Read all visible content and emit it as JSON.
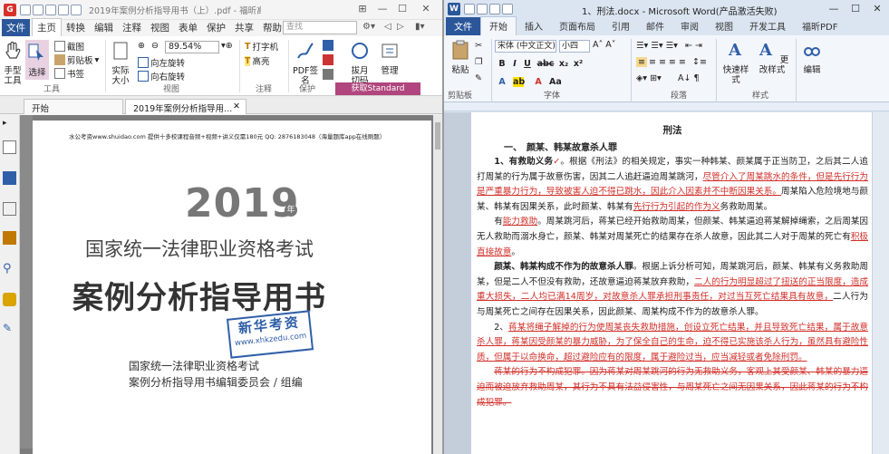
{
  "left_app": {
    "title": "2019年案例分析指导用书（上）.pdf - 福昕高级PD...",
    "tabs": [
      "文件",
      "主页",
      "转换",
      "编辑",
      "注释",
      "视图",
      "表单",
      "保护",
      "共享",
      "帮助"
    ],
    "search_placeholder": "查找",
    "ribbon": {
      "hand_tool": "手型工具",
      "select": "选择",
      "screenshot": "截图",
      "clipboard": "剪贴板",
      "bookmark": "书签",
      "group_tools": "工具",
      "actual_size": "实际大小",
      "zoom": "89.54%",
      "rotate_left": "向左旋转",
      "rotate_right": "向右旋转",
      "group_view": "视图",
      "typewriter": "打字机",
      "highlight": "高亮",
      "group_comment": "注释",
      "pdf_sign": "PDF签名",
      "group_protect": "保护",
      "fill": "拔月",
      "fill2": "切码",
      "manage": "管理",
      "get_standard": "获取Standard"
    },
    "doc_tabs": [
      "开始",
      "2019年案例分析指导用..."
    ],
    "page": {
      "header": "水公考资www.shuidao.com    提供十多校课程音频+视频+讲义仅需180元    QQ: 2876183048（海量题库app在线刷题）",
      "year": "2019",
      "nian": "年",
      "subtitle": "国家统一法律职业资格考试",
      "main_title": "案例分析指导用书",
      "stamp_line1": "新华考资",
      "stamp_line2": "www.xhkzedu.com",
      "org_line1": "国家统一法律职业资格考试",
      "org_line2": "案例分析指导用书编辑委员会 / 组编"
    }
  },
  "right_app": {
    "title": "1、刑法.docx - Microsoft Word(产品激活失败)",
    "tabs": [
      "文件",
      "开始",
      "插入",
      "页面布局",
      "引用",
      "邮件",
      "审阅",
      "视图",
      "开发工具",
      "福昕PDF"
    ],
    "ribbon": {
      "paste": "粘贴",
      "font_name": "宋体 (中文正文)",
      "font_size": "小四",
      "group_clipboard": "剪贴板",
      "group_font": "字体",
      "group_paragraph": "段落",
      "quick_styles": "快速样式",
      "change_styles": "更改样式",
      "edit": "编辑",
      "group_styles": "样式"
    },
    "doc": {
      "title": "刑法",
      "heading": "一、　颜某、韩某故意杀人罪",
      "p1_bold": "1、有救助义务",
      "p1_check": "✓",
      "p1_a": "。根据《刑法》的相关规定，事实一种韩某、颜某属于正当防卫，之后其二人追打周某的行为属于故意伤害，因其二人追赶逼迫周某跳河，",
      "p1_red": "尽管介入了周某跳水的条件，但是先行行为是严重暴力行为，导致被害人迫不得已跳水，因此介入因素并不中断因果关系。",
      "p1_b": "周某陷入危险境地与颜某、韩某有因果关系，此时颜某、韩某有",
      "p1_red2": "先行行为引起的作为义",
      "p1_c": "务救助周某。",
      "p2_a": "有",
      "p2_red": "能力救助",
      "p2_b": "。周某跳河后，蒋某已经开始救助周某，但颜某、韩某逼迫蒋某解掉绳索，之后周某因无人救助而溺水身亡，颜某、韩某对周某死亡的结果存在杀人故意，因此其二人对于周某的死亡有",
      "p2_red2": "积极直接故意",
      "p2_c": "。",
      "p3_bold": "颜某、韩某构成不作为的故意杀人罪",
      "p3_a": "。根据上诉分析可知，周某跳河后，颜某、韩某有义务救助周某，但是二人不但没有救助，还故意逼迫蒋某放弃救助，",
      "p3_red": "二人的行为明显超过了扭送的正当限度，造成重大损失，二人均已满14周岁，对故意杀人罪承担刑事责任，对过当互死亡结果具有故意，",
      "p3_b": "二人行为与周某死亡之间存在因果关系，因此颜某、周某构成不作为的故意杀人罪。",
      "p4_a": "2、",
      "p4_red": "蒋某将绳子解掉的行为使周某丧失救助措施，创设立死亡结果，并且导致死亡结果，属于故意杀人罪，蒋某因受颜某的暴力威胁，为了保全自己的生命，迫不得已实施该杀人行为，虽然具有避险性质，但属于以命换命，超过避险应有的限度，属于避险过当，应当减轻或者免除刑罚。",
      "p5_strike": "蒋某的行为不构成犯罪。因为蒋某对周某跳河的行为无救助义务，客观上其受颜某、韩某的暴力逼迫而被迫放弃救助周某，其行为不具有法益侵害性，与周某死亡之间无因果关系，因此蒋某的行为不构成犯罪。"
    }
  },
  "colors": {
    "word_blue": "#2b579a",
    "foxit_select_bg": "#e8d2e2",
    "get_btn": "#b0467d",
    "red_revision": "#d0302a",
    "stamp_blue": "#2f5fa8"
  }
}
